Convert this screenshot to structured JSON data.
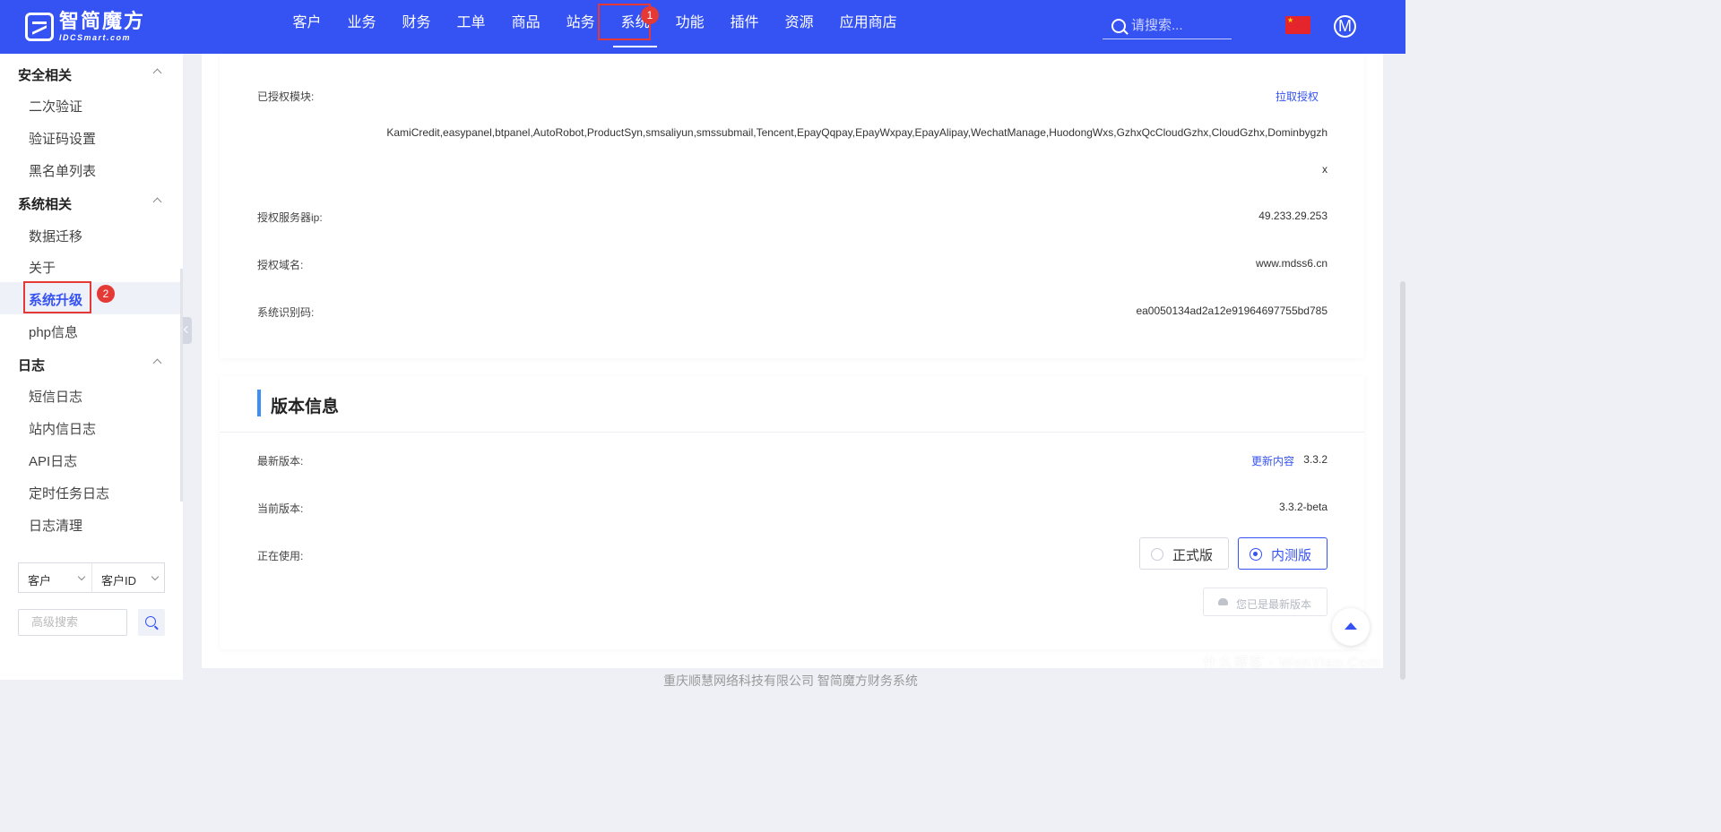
{
  "logo": {
    "cn": "智简魔方",
    "en": "IDCSmart.com"
  },
  "nav": {
    "items": [
      "客户",
      "业务",
      "财务",
      "工单",
      "商品",
      "站务",
      "系统",
      "功能",
      "插件",
      "资源",
      "应用商店"
    ],
    "badge": "1"
  },
  "search": {
    "placeholder": "请搜索..."
  },
  "avatar": {
    "letter": "M"
  },
  "sidebar": {
    "group_security": "安全相关",
    "security_items": [
      "二次验证",
      "验证码设置",
      "黑名单列表"
    ],
    "group_system": "系统相关",
    "system_items": [
      "数据迁移",
      "关于",
      "系统升级",
      "php信息"
    ],
    "active_badge": "2",
    "group_log": "日志",
    "log_items": [
      "短信日志",
      "站内信日志",
      "API日志",
      "定时任务日志",
      "日志清理"
    ],
    "filter_select_1": "客户",
    "filter_select_2": "客户ID",
    "adv_search_placeholder": "高级搜索"
  },
  "license": {
    "modules_label": "已授权模块:",
    "pull_link": "拉取授权",
    "modules_line1": "KamiCredit,easypanel,btpanel,AutoRobot,ProductSyn,smsaliyun,smssubmail,Tencent,EpayQqpay,EpayWxpay,EpayAlipay,WechatManage,HuodongWxs,GzhxQcCloudGzhx,CloudGzhx,Dominbygzh",
    "modules_line2": "x",
    "ip_label": "授权服务器ip:",
    "ip_value": "49.233.29.253",
    "domain_label": "授权域名:",
    "domain_value": "www.mdss6.cn",
    "code_label": "系统识别码:",
    "code_value": "ea0050134ad2a12e91964697755bd785"
  },
  "version": {
    "title": "版本信息",
    "latest_label": "最新版本:",
    "update_link": "更新内容",
    "latest_value": "3.3.2",
    "current_label": "当前版本:",
    "current_value": "3.3.2-beta",
    "using_label": "正在使用:",
    "option_stable": "正式版",
    "option_beta": "内测版",
    "selected": "内测版",
    "latest_btn": "您已是最新版本"
  },
  "footer": "重庆顺慧网络科技有限公司 智简魔方财务系统",
  "watermark": "什么博客 · WenYiao.Com",
  "colors": {
    "primary": "#3552f2",
    "highlight": "#e53935",
    "accent_bar": "#3b8ff5"
  }
}
